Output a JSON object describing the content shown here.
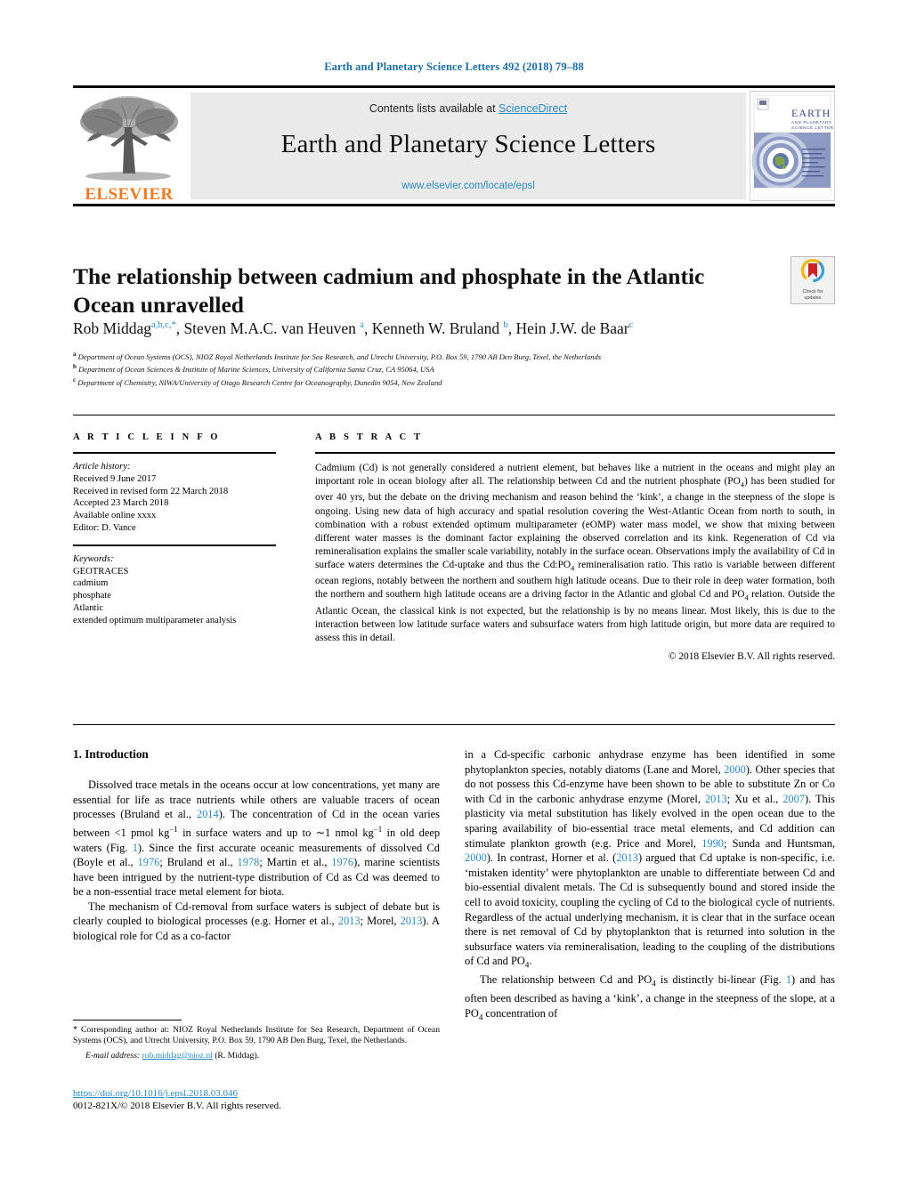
{
  "header": {
    "running_head": "Earth and Planetary Science Letters 492 (2018) 79–88"
  },
  "masthead": {
    "contents_prefix": "Contents lists available at ",
    "sciencedirect_link": "ScienceDirect",
    "journal_title": "Earth and Planetary Science Letters",
    "journal_url": "www.elsevier.com/locate/epsl",
    "publisher_logo_text": "ELSEVIER",
    "cover_title_line1": "EARTH",
    "cover_title_line2": "AND PLANETARY",
    "cover_title_line3": "SCIENCE LETTERS"
  },
  "article": {
    "title": "The relationship between cadmium and phosphate in the Atlantic Ocean unravelled",
    "crossmark_line1": "Check for",
    "crossmark_line2": "updates",
    "authors_html": "Rob Middag<sup>a,b,c,*</sup>, Steven M.A.C. van Heuven <sup>a</sup>, Kenneth W. Bruland <sup>b</sup>, Hein J.W. de Baar<sup>c</sup>",
    "affiliations": [
      "Department of Ocean Systems (OCS), NIOZ Royal Netherlands Institute for Sea Research, and Utrecht University, P.O. Box 59, 1790 AB Den Burg, Texel, the Netherlands",
      "Department of Ocean Sciences & Institute of Marine Sciences, University of California Santa Cruz, CA 95064, USA",
      "Department of Chemistry, NIWA/University of Otago Research Centre for Oceanography, Dunedin 9054, New Zealand"
    ],
    "affiliation_markers": [
      "a",
      "b",
      "c"
    ]
  },
  "article_info": {
    "heading": "A R T I C L E   I N F O",
    "history_label": "Article history:",
    "history": [
      "Received 9 June 2017",
      "Received in revised form 22 March 2018",
      "Accepted 23 March 2018",
      "Available online xxxx",
      "Editor: D. Vance"
    ],
    "keywords_label": "Keywords:",
    "keywords": [
      "GEOTRACES",
      "cadmium",
      "phosphate",
      "Atlantic",
      "extended optimum multiparameter analysis"
    ]
  },
  "abstract": {
    "heading": "A B S T R A C T",
    "text_html": "Cadmium (Cd) is not generally considered a nutrient element, but behaves like a nutrient in the oceans and might play an important role in ocean biology after all. The relationship between Cd and the nutrient phosphate (PO<sub>4</sub>) has been studied for over 40 yrs, but the debate on the driving mechanism and reason behind the ‘kink’, a change in the steepness of the slope is ongoing. Using new data of high accuracy and spatial resolution covering the West-Atlantic Ocean from north to south, in combination with a robust extended optimum multiparameter (eOMP) water mass model, we show that mixing between different water masses is the dominant factor explaining the observed correlation and its kink. Regeneration of Cd via remineralisation explains the smaller scale variability, notably in the surface ocean. Observations imply the availability of Cd in surface waters determines the Cd-uptake and thus the Cd:PO<sub>4</sub> remineralisation ratio. This ratio is variable between different ocean regions, notably between the northern and southern high latitude oceans. Due to their role in deep water formation, both the northern and southern high latitude oceans are a driving factor in the Atlantic and global Cd and PO<sub>4</sub> relation. Outside the Atlantic Ocean, the classical kink is not expected, but the relationship is by no means linear. Most likely, this is due to the interaction between low latitude surface waters and subsurface waters from high latitude origin, but more data are required to assess this in detail.",
    "copyright": "© 2018 Elsevier B.V. All rights reserved."
  },
  "body": {
    "section_heading": "1. Introduction",
    "left_paragraphs_html": [
      "Dissolved trace metals in the oceans occur at low concentrations, yet many are essential for life as trace nutrients while others are valuable tracers of ocean processes (Bruland et al., <span class=\"ref\">2014</span>). The concentration of Cd in the ocean varies between &lt;1 pmol kg<sup class=\"small\">−1</sup> in surface waters and up to ∼1 nmol kg<sup class=\"small\">−1</sup> in old deep waters (Fig. <span class=\"ref\">1</span>). Since the first accurate oceanic measurements of dissolved Cd (Boyle et al., <span class=\"ref\">1976</span>; Bruland et al., <span class=\"ref\">1978</span>; Martin et al., <span class=\"ref\">1976</span>), marine scientists have been intrigued by the nutrient-type distribution of Cd as Cd was deemed to be a non-essential trace metal element for biota.",
      "The mechanism of Cd-removal from surface waters is subject of debate but is clearly coupled to biological processes (e.g. Horner et al., <span class=\"ref\">2013</span>; Morel, <span class=\"ref\">2013</span>). A biological role for Cd as a co-factor"
    ],
    "right_paragraphs_html": [
      "in a Cd-specific carbonic anhydrase enzyme has been identified in some phytoplankton species, notably diatoms (Lane and Morel, <span class=\"ref\">2000</span>). Other species that do not possess this Cd-enzyme have been shown to be able to substitute Zn or Co with Cd in the carbonic anhydrase enzyme (Morel, <span class=\"ref\">2013</span>; Xu et al., <span class=\"ref\">2007</span>). This plasticity via metal substitution has likely evolved in the open ocean due to the sparing availability of bio-essential trace metal elements, and Cd addition can stimulate plankton growth (e.g. Price and Morel, <span class=\"ref\">1990</span>; Sunda and Huntsman, <span class=\"ref\">2000</span>). In contrast, Horner et al. (<span class=\"ref\">2013</span>) argued that Cd uptake is non-specific, i.e. ‘mistaken identity’ were phytoplankton are unable to differentiate between Cd and bio-essential divalent metals. The Cd is subsequently bound and stored inside the cell to avoid toxicity, coupling the cycling of Cd to the biological cycle of nutrients. Regardless of the actual underlying mechanism, it is clear that in the surface ocean there is net removal of Cd by phytoplankton that is returned into solution in the subsurface waters via remineralisation, leading to the coupling of the distributions of Cd and PO<sub>4</sub>.",
      "The relationship between Cd and PO<sub>4</sub> is distinctly bi-linear (Fig. <span class=\"ref\">1</span>) and has often been described as having a ‘kink’, a change in the steepness of the slope, at a PO<sub>4</sub> concentration of"
    ]
  },
  "footnotes": {
    "corresponding_marker": "*",
    "corresponding_text": "Corresponding author at: NIOZ Royal Netherlands Institute for Sea Research, Department of Ocean Systems (OCS), and Utrecht University, P.O. Box 59, 1790 AB Den Burg, Texel, the Netherlands.",
    "email_label": "E-mail address:",
    "email_address": "rob.middag@nioz.nl",
    "email_attribution": "(R. Middag).",
    "doi": "https://doi.org/10.1016/j.epsl.2018.03.046",
    "issn_line": "0012-821X/© 2018 Elsevier B.V. All rights reserved."
  },
  "colors": {
    "link_blue": "#2a8bc4",
    "running_head_blue": "#1a6ea8",
    "elsevier_orange": "#EE7A23",
    "band_grey": "#eaeaea"
  }
}
